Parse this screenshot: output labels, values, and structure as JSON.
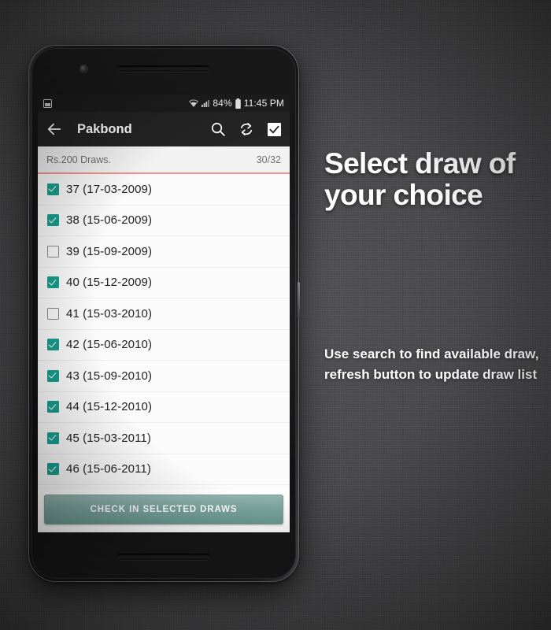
{
  "promo": {
    "headline": "Select draw of your choice",
    "subcopy": "Use search to find available draw, refresh button to update draw list"
  },
  "colors": {
    "backdrop": "#4a4a4c",
    "status_bar": "#1c1c1c",
    "app_bar": "#232323",
    "accent_checkbox": "#199e8e",
    "header_divider": "#f1938d",
    "button_teal": "#7ea6a0",
    "screen_background": "#fbfbfb"
  },
  "status_bar": {
    "left_icon": "screenshot-icon",
    "wifi_icon": "wifi-icon",
    "signal_icon": "signal-bars-icon",
    "battery_percent": "84%",
    "battery_icon": "battery-icon",
    "time": "11:45 PM"
  },
  "app_bar": {
    "back_icon": "back-arrow-icon",
    "title": "Pakbond",
    "actions": [
      {
        "name": "search-icon",
        "label": "Search"
      },
      {
        "name": "refresh-icon",
        "label": "Refresh"
      },
      {
        "name": "select-all-checkbox-icon",
        "label": "Select all"
      }
    ]
  },
  "list_header": {
    "label": "Rs.200 Draws.",
    "count": "30/32"
  },
  "draws": [
    {
      "label": "37 (17-03-2009)",
      "checked": true
    },
    {
      "label": "38 (15-06-2009)",
      "checked": true
    },
    {
      "label": "39 (15-09-2009)",
      "checked": false
    },
    {
      "label": "40 (15-12-2009)",
      "checked": true
    },
    {
      "label": "41 (15-03-2010)",
      "checked": false
    },
    {
      "label": "42 (15-06-2010)",
      "checked": true
    },
    {
      "label": "43 (15-09-2010)",
      "checked": true
    },
    {
      "label": "44 (15-12-2010)",
      "checked": true
    },
    {
      "label": "45 (15-03-2011)",
      "checked": true
    },
    {
      "label": "46 (15-06-2011)",
      "checked": true
    }
  ],
  "footer": {
    "button_label": "CHECK IN SELECTED DRAWS"
  }
}
